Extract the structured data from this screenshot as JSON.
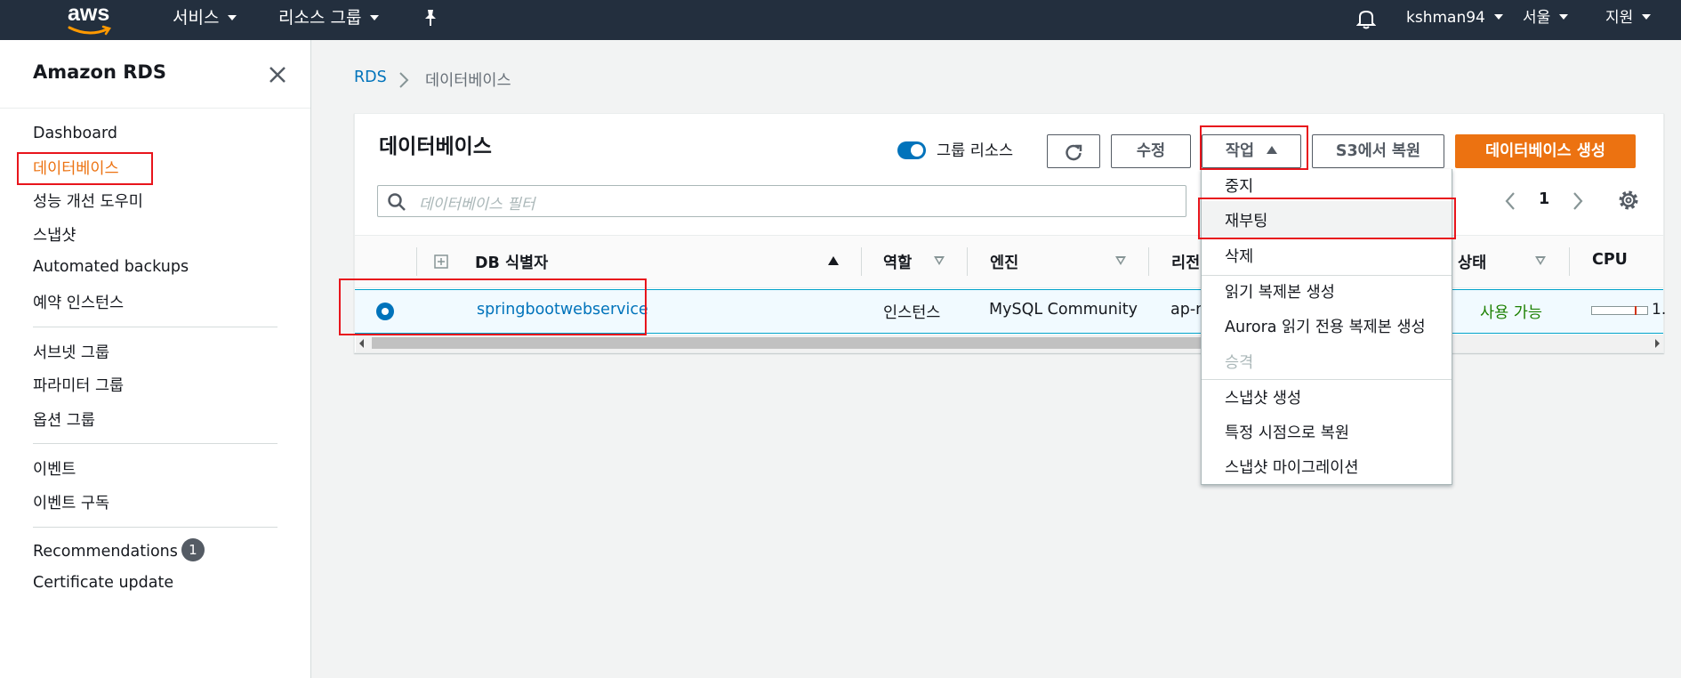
{
  "topnav": {
    "logo_text": "aws",
    "services": "서비스",
    "resource_groups": "리소스 그룹",
    "username": "kshman94",
    "region": "서울",
    "support": "지원"
  },
  "sidebar": {
    "title": "Amazon RDS",
    "items": [
      {
        "label": "Dashboard"
      },
      {
        "label": "데이터베이스"
      },
      {
        "label": "성능 개선 도우미"
      },
      {
        "label": "스냅샷"
      },
      {
        "label": "Automated backups"
      },
      {
        "label": "예약 인스턴스"
      },
      {
        "label": "서브넷 그룹"
      },
      {
        "label": "파라미터 그룹"
      },
      {
        "label": "옵션 그룹"
      },
      {
        "label": "이벤트"
      },
      {
        "label": "이벤트 구독"
      },
      {
        "label": "Recommendations",
        "badge": "1"
      },
      {
        "label": "Certificate update"
      }
    ]
  },
  "breadcrumb": {
    "root": "RDS",
    "current": "데이터베이스"
  },
  "panel": {
    "title": "데이터베이스",
    "group_resources_label": "그룹 리소스",
    "group_resources_on": true,
    "modify_label": "수정",
    "actions_label": "작업",
    "restore_s3_label": "S3에서 복원",
    "create_label": "데이터베이스 생성",
    "filter_placeholder": "데이터베이스 필터",
    "page": "1"
  },
  "table": {
    "columns": [
      "DB 식별자",
      "역할",
      "엔진",
      "리전",
      "상태",
      "CPU"
    ],
    "rows": [
      {
        "identifier": "springbootwebservice",
        "role": "인스턴스",
        "engine": "MySQL Community",
        "region": "ap-n",
        "status": "사용 가능",
        "cpu": "1.",
        "cpu_fraction": 0.78
      }
    ]
  },
  "actions_menu": {
    "items": [
      {
        "label": "중지",
        "disabled": false
      },
      {
        "label": "재부팅",
        "disabled": false,
        "highlighted": true
      },
      {
        "label": "삭제",
        "disabled": false
      },
      {
        "label": "읽기 복제본 생성",
        "disabled": false
      },
      {
        "label": "Aurora 읽기 전용 복제본 생성",
        "disabled": false
      },
      {
        "label": "승격",
        "disabled": true
      },
      {
        "label": "스냅샷 생성",
        "disabled": false
      },
      {
        "label": "특정 시점으로 복원",
        "disabled": false
      },
      {
        "label": "스냅샷 마이그레이션",
        "disabled": false
      }
    ]
  },
  "colors": {
    "nav_bg": "#232f3e",
    "accent_orange": "#ec7211",
    "link_blue": "#0073bb",
    "status_green": "#1d8102",
    "annotation_red": "#e8151c"
  }
}
